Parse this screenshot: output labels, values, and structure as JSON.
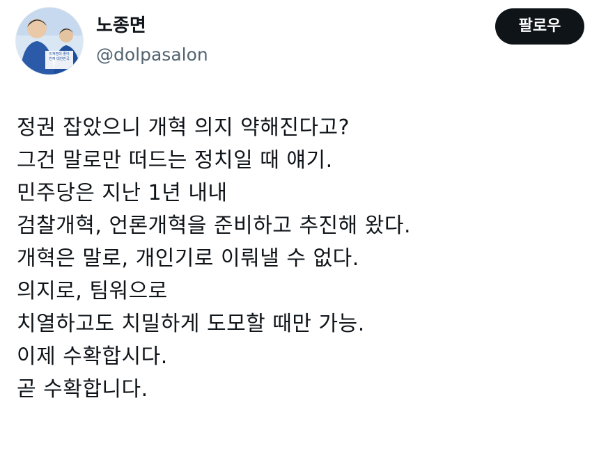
{
  "author": {
    "display_name": "노종면",
    "username": "@dolpasalon",
    "avatar_icon": "profile-photo-icon",
    "avatar_banner_lines": [
      "이재명이 좋아",
      "진짜 대한민국"
    ]
  },
  "actions": {
    "follow_label": "팔로우"
  },
  "tweet": {
    "lines": [
      "정권 잡았으니 개혁 의지 약해진다고?",
      "그건 말로만 떠드는 정치일 때 얘기.",
      "민주당은 지난 1년 내내",
      "검찰개혁, 언론개혁을 준비하고 추진해 왔다.",
      "개혁은 말로, 개인기로 이뤄낼 수 없다.",
      "의지로, 팀워으로",
      "치열하고도 치밀하게 도모할 때만 가능.",
      "이제 수확합시다.",
      "곧 수확합니다."
    ]
  },
  "colors": {
    "text": "#0f1419",
    "secondary_text": "#536471",
    "button_bg": "#0f1419",
    "button_text": "#ffffff",
    "background": "#ffffff"
  }
}
